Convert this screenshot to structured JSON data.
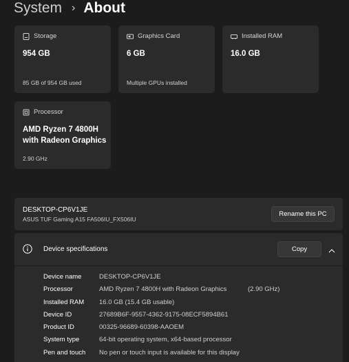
{
  "breadcrumb": {
    "parent": "System",
    "separator": "›",
    "current": "About"
  },
  "tiles": {
    "storage": {
      "icon": "storage-icon",
      "title": "Storage",
      "value": "954 GB",
      "sub": "85 GB of 954 GB used"
    },
    "graphics": {
      "icon": "graphics-card-icon",
      "title": "Graphics Card",
      "value": "6 GB",
      "sub": "Multiple GPUs installed"
    },
    "ram": {
      "icon": "ram-icon",
      "title": "Installed RAM",
      "value": "16.0 GB",
      "sub": ""
    },
    "processor": {
      "icon": "processor-icon",
      "title": "Processor",
      "value_line1": "AMD Ryzen 7 4800H",
      "value_line2": "with Radeon Graphics",
      "sub": "2.90 GHz"
    }
  },
  "pc": {
    "name": "DESKTOP-CP6V1JE",
    "model": "ASUS TUF Gaming A15 FA506IU_FX506IU",
    "rename_label": "Rename this PC"
  },
  "specs": {
    "title": "Device specifications",
    "copy_label": "Copy",
    "rows": [
      {
        "label": "Device name",
        "value": "DESKTOP-CP6V1JE",
        "extra": ""
      },
      {
        "label": "Processor",
        "value": "AMD Ryzen 7 4800H with Radeon Graphics",
        "extra": "(2.90 GHz)"
      },
      {
        "label": "Installed RAM",
        "value": "16.0 GB (15.4 GB usable)",
        "extra": ""
      },
      {
        "label": "Device ID",
        "value": "27689B6F-9557-4362-9175-08ECF5894B61",
        "extra": ""
      },
      {
        "label": "Product ID",
        "value": "00325-96689-60398-AAOEM",
        "extra": ""
      },
      {
        "label": "System type",
        "value": "64-bit operating system, x64-based processor",
        "extra": ""
      },
      {
        "label": "Pen and touch",
        "value": "No pen or touch input is available for this display",
        "extra": ""
      }
    ]
  },
  "colors": {
    "background": "#1c1c1c",
    "card": "#2b2b2b",
    "button": "#373737"
  }
}
